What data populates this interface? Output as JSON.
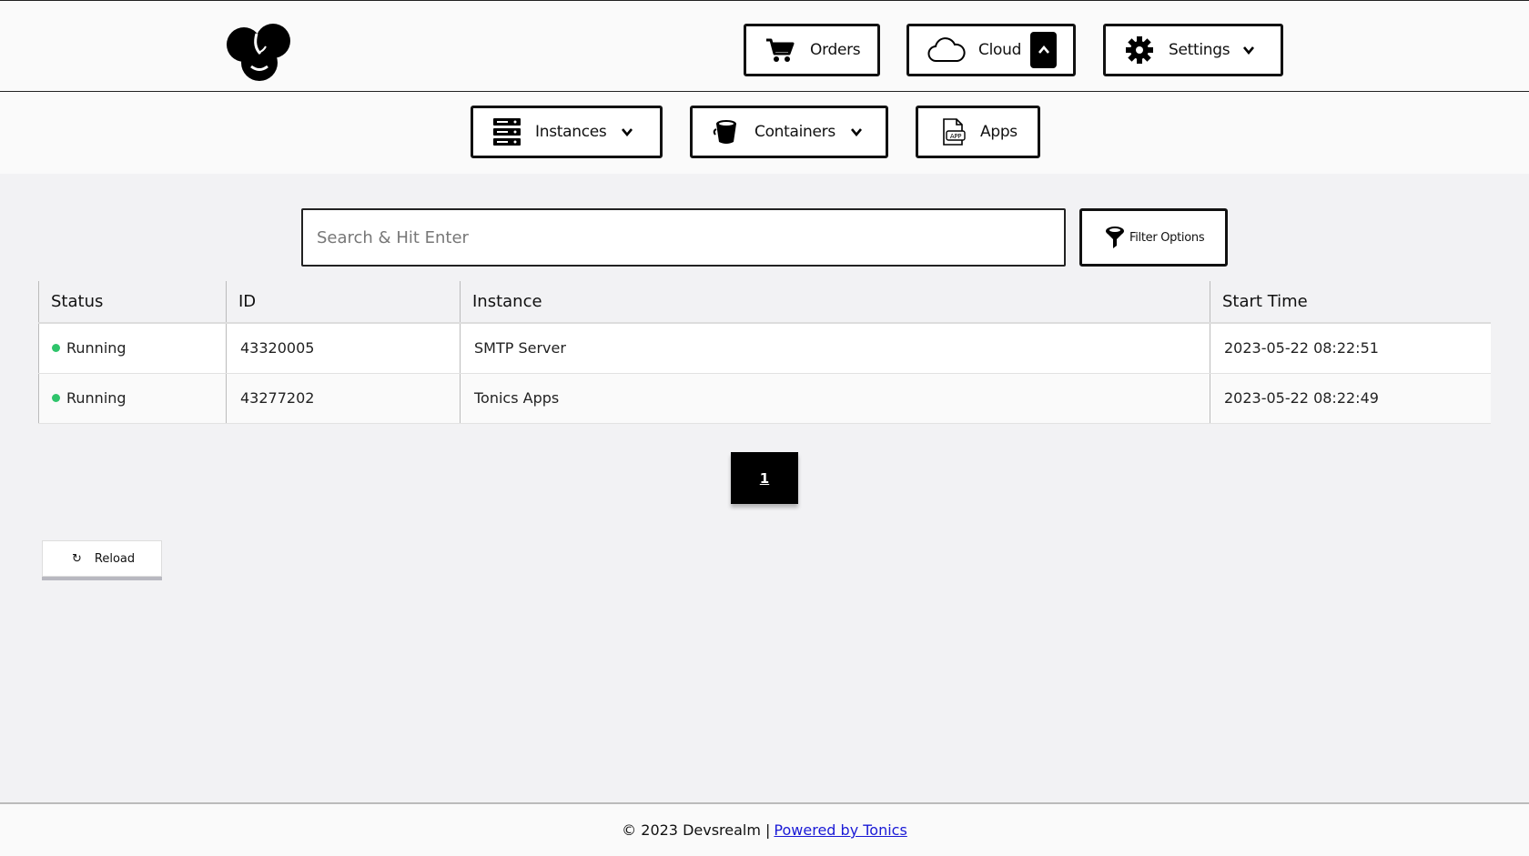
{
  "header": {
    "orders_label": "Orders",
    "cloud_label": "Cloud",
    "settings_label": "Settings"
  },
  "subnav": {
    "instances_label": "Instances",
    "containers_label": "Containers",
    "apps_label": "Apps"
  },
  "search": {
    "placeholder": "Search & Hit Enter",
    "value": ""
  },
  "filter": {
    "label": "Filter Options"
  },
  "table": {
    "headers": [
      "Status",
      "ID",
      "Instance",
      "Start Time"
    ],
    "rows": [
      {
        "status": "Running",
        "id": "43320005",
        "instance": "SMTP Server",
        "start_time": "2023-05-22 08:22:51"
      },
      {
        "status": "Running",
        "id": "43277202",
        "instance": "Tonics Apps",
        "start_time": "2023-05-22 08:22:49"
      }
    ]
  },
  "pagination": {
    "current_page": "1"
  },
  "reload": {
    "icon": "↻",
    "label": "Reload"
  },
  "footer": {
    "copyright": "© 2023 Devsrealm |",
    "link_text": "Powered by Tonics"
  },
  "colors": {
    "status_running": "#2ec46b",
    "link": "#1a1ad6"
  }
}
